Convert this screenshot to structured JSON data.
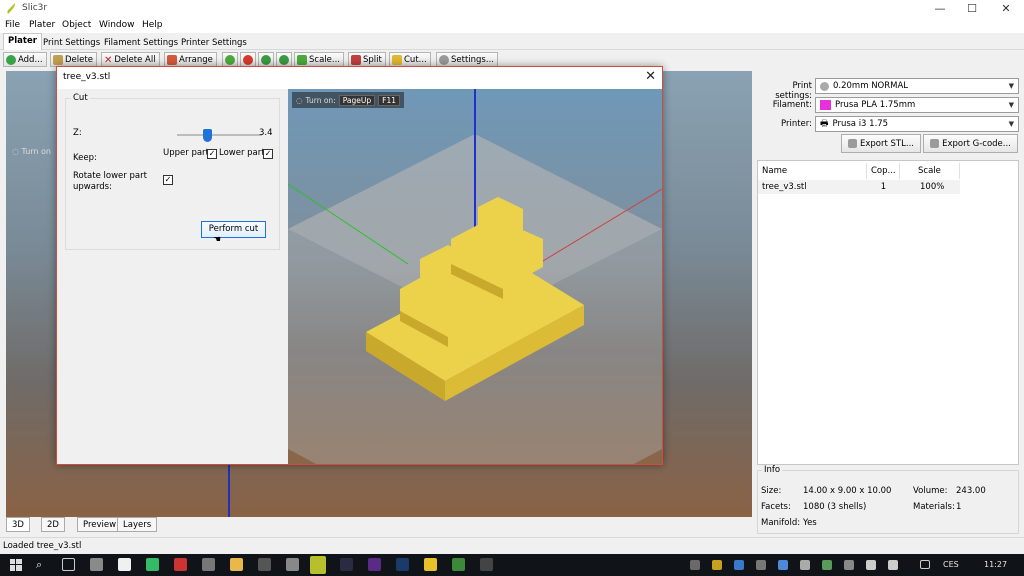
{
  "window": {
    "title": "Slic3r",
    "minimize": "—",
    "maximize": "☐",
    "close": "✕"
  },
  "menu": [
    "File",
    "Plater",
    "Object",
    "Window",
    "Help"
  ],
  "tabs": [
    "Plater",
    "Print Settings",
    "Filament Settings",
    "Printer Settings"
  ],
  "toolbar": {
    "add": "Add...",
    "delete": "Delete",
    "delete_all": "Delete All",
    "arrange": "Arrange",
    "scale": "Scale...",
    "split": "Split",
    "cut": "Cut...",
    "settings": "Settings..."
  },
  "viewport": {
    "hint": "Turn on"
  },
  "view_tabs": [
    "3D",
    "2D",
    "Preview",
    "Layers"
  ],
  "right": {
    "print_settings_label": "Print settings:",
    "print_settings_value": "0.20mm NORMAL",
    "filament_label": "Filament:",
    "filament_value": "Prusa PLA 1.75mm",
    "filament_color": "#e632d8",
    "printer_label": "Printer:",
    "printer_value": "Prusa i3 1.75",
    "export_stl": "Export STL...",
    "export_gcode": "Export G-code...",
    "columns": [
      "Name",
      "Cop...",
      "Scale"
    ],
    "rows": [
      {
        "name": "tree_v3.stl",
        "copies": "1",
        "scale": "100%"
      }
    ]
  },
  "info": {
    "title": "Info",
    "size_label": "Size:",
    "size_value": "14.00 x 9.00 x 10.00",
    "volume_label": "Volume:",
    "volume_value": "243.00",
    "facets_label": "Facets:",
    "facets_value": "1080 (3 shells)",
    "materials_label": "Materials:",
    "materials_value": "1",
    "manifold_label": "Manifold:",
    "manifold_value": "Yes"
  },
  "status": "Loaded tree_v3.stl",
  "dialog": {
    "title": "tree_v3.stl",
    "close": "✕",
    "group": "Cut",
    "z_label": "Z:",
    "z_value": "3.4",
    "keep_label": "Keep:",
    "upper_part": "Upper part",
    "upper_checked": "✓",
    "lower_part": "Lower part",
    "lower_checked": "✓",
    "rotate_line1": "Rotate lower part",
    "rotate_line2": "upwards:",
    "rotate_checked": "✓",
    "perform_cut": "Perform cut",
    "preview_hint": "Turn on:",
    "key1": "PageUp",
    "key2": "F11"
  },
  "taskbar": {
    "lang": "CES",
    "time": "11:27"
  },
  "colors": {
    "model": "#ecd24a",
    "model_side": "#c9a92c",
    "accent": "#1e73d8",
    "dialog_border": "#d04c3c"
  }
}
